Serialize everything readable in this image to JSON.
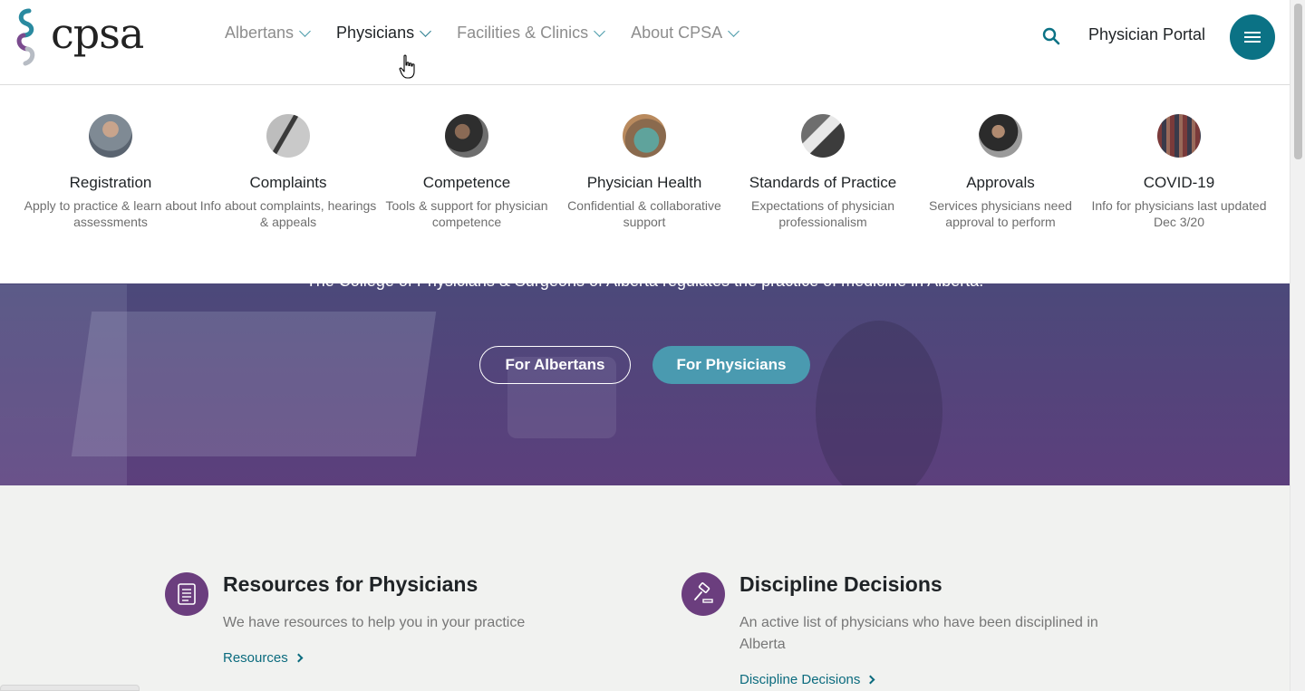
{
  "header": {
    "logo_text": "cpsa",
    "nav": [
      {
        "label": "Albertans"
      },
      {
        "label": "Physicians"
      },
      {
        "label": "Facilities & Clinics"
      },
      {
        "label": "About CPSA"
      }
    ],
    "portal_label": "Physician Portal"
  },
  "mega_menu": {
    "items": [
      {
        "title": "Registration",
        "desc": "Apply to practice & learn about assessments"
      },
      {
        "title": "Complaints",
        "desc": "Info about complaints, hearings & appeals"
      },
      {
        "title": "Competence",
        "desc": "Tools & support for physician competence"
      },
      {
        "title": "Physician Health",
        "desc": "Confidential & collaborative support"
      },
      {
        "title": "Standards of Practice",
        "desc": "Expectations of physician professionalism"
      },
      {
        "title": "Approvals",
        "desc": "Services physicians need approval to perform"
      },
      {
        "title": "COVID-19",
        "desc": "Info for physicians last updated Dec 3/20"
      }
    ]
  },
  "hero": {
    "text": "The College of Physicians & Surgeons of Alberta regulates the practice of medicine in Alberta.",
    "btn_albertans": "For Albertans",
    "btn_physicians": "For Physicians"
  },
  "cards": {
    "resources": {
      "title": "Resources for Physicians",
      "desc": "We have resources to help you in your practice",
      "link": "Resources"
    },
    "discipline": {
      "title": "Discipline Decisions",
      "desc": "An active list of physicians who have been disciplined in Alberta",
      "link": "Discipline Decisions"
    }
  },
  "colors": {
    "brand_teal": "#0b7285",
    "brand_purple": "#6b3e7e",
    "button_teal": "#4a9ab0"
  }
}
